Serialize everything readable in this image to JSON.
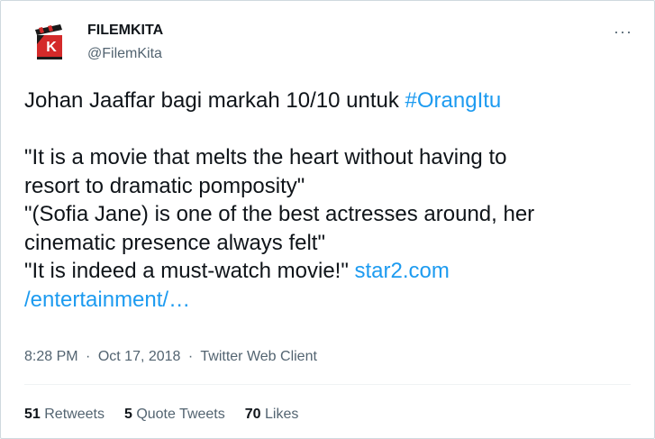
{
  "author": {
    "name": "FILEMKITA",
    "handle": "@FilemKita",
    "more_glyph": "···"
  },
  "tweet": {
    "line1_text": "Johan Jaaffar bagi markah 10/10 untuk ",
    "hashtag": "#OrangItu",
    "quote1_a": "\"It is a movie that melts the heart without having to",
    "quote1_b": "resort to dramatic pomposity\"",
    "quote2_a": "\"(Sofia Jane) is one of the best actresses around, her",
    "quote2_b": "cinematic presence always felt\"",
    "quote3": "\"It is indeed a must-watch movie!\" ",
    "link_a": "star2.com",
    "link_b": "/entertainment/…"
  },
  "meta": {
    "time": "8:28 PM",
    "date": "Oct 17, 2018",
    "client": "Twitter Web Client",
    "separator": "·"
  },
  "stats": {
    "retweets_count": "51",
    "retweets_label": "Retweets",
    "quotes_count": "5",
    "quotes_label": "Quote Tweets",
    "likes_count": "70",
    "likes_label": "Likes"
  },
  "colors": {
    "link": "#1d9bf0",
    "secondary": "#536471",
    "logo_red": "#d42a2a"
  }
}
